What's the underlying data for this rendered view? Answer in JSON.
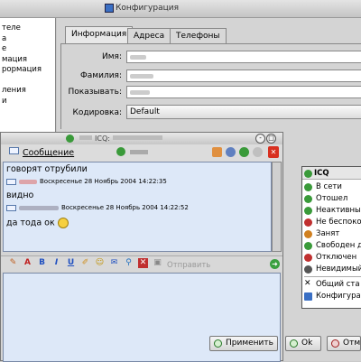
{
  "window": {
    "title": "Конфигурация"
  },
  "left_panel": {
    "items": [
      "теле",
      "а",
      "е",
      "мация",
      "рормация",
      "",
      "ления",
      "и"
    ]
  },
  "tabs": [
    {
      "label": "Информация"
    },
    {
      "label": "Адреса"
    },
    {
      "label": "Телефоны"
    }
  ],
  "form": {
    "name_label": "Имя:",
    "surname_label": "Фамилия:",
    "display_label": "Показывать:",
    "encoding_label": "Кодировка:",
    "encoding_value": "Default"
  },
  "chat": {
    "title": "ICQ:",
    "message_label": "Сообщение",
    "messages": [
      {
        "text": "говорят отрубили",
        "meta": "Воскресенье 28 Ноябрь 2004 14:22:35"
      },
      {
        "text": "видно",
        "meta": "Воскресенье 28 Ноябрь 2004 14:22:52"
      },
      {
        "text": "да тода ок",
        "meta": ""
      }
    ],
    "send_label": "Отправить"
  },
  "status_menu": {
    "header": "ICQ",
    "items": [
      {
        "label": "В сети",
        "color": "#3a9a3a"
      },
      {
        "label": "Отошел",
        "color": "#3a9a3a"
      },
      {
        "label": "Неактивный",
        "color": "#3a9a3a"
      },
      {
        "label": "Не беспоко",
        "color": "#c03030"
      },
      {
        "label": "Занят",
        "color": "#d08020"
      },
      {
        "label": "Свободен д",
        "color": "#3a9a3a"
      },
      {
        "label": "Отключен",
        "color": "#c03030"
      },
      {
        "label": "Невидимый",
        "color": "#555555"
      },
      {
        "label": "Общий ста",
        "color": "#000000"
      },
      {
        "label": "Конфигура",
        "color": "#3a6fc4"
      }
    ]
  },
  "buttons": {
    "apply": "Применить",
    "ok": "Ok",
    "cancel": "Отм"
  }
}
